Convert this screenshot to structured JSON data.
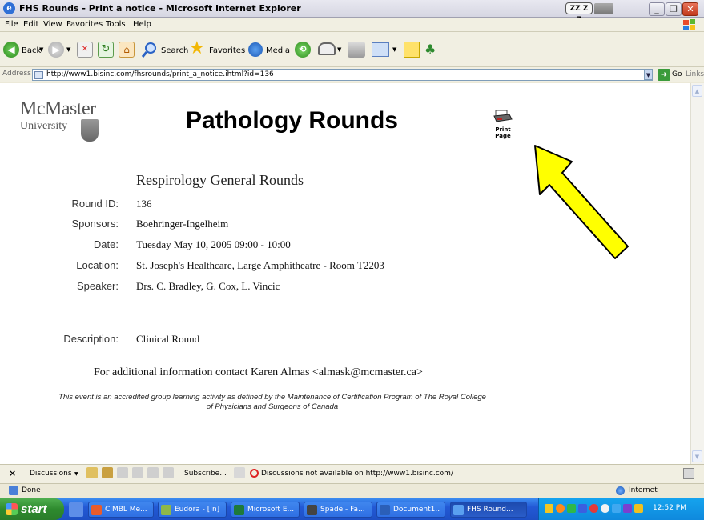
{
  "window": {
    "title": "FHS Rounds - Print a notice - Microsoft Internet Explorer",
    "zz_label": "ZZ Z Z"
  },
  "menu": [
    "File",
    "Edit",
    "View",
    "Favorites",
    "Tools",
    "Help"
  ],
  "toolbar": {
    "back_label": "Back",
    "search_label": "Search",
    "favorites_label": "Favorites",
    "media_label": "Media"
  },
  "address": {
    "label": "Address",
    "url": "http://www1.bisinc.com/fhsrounds/print_a_notice.ihtml?id=136",
    "go_label": "Go",
    "links_label": "Links"
  },
  "page": {
    "logo_line1": "McMaster",
    "logo_line2": "University",
    "title": "Pathology Rounds",
    "print_label_1": "Print",
    "print_label_2": "Page",
    "event_title": "Respirology General Rounds",
    "fields": [
      {
        "label": "Round ID:",
        "value": "136"
      },
      {
        "label": "Sponsors:",
        "value": "Boehringer-Ingelheim"
      },
      {
        "label": "Date:",
        "value": "Tuesday May 10, 2005 09:00 - 10:00"
      },
      {
        "label": "Location:",
        "value": "St. Joseph's Healthcare, Large Amphitheatre - Room T2203"
      },
      {
        "label": "Speaker:",
        "value": "Drs. C. Bradley, G. Cox, L. Vincic"
      }
    ],
    "description_label": "Description:",
    "description_value": "Clinical Round",
    "contact": "For additional information contact Karen Almas <almask@mcmaster.ca>",
    "accreditation_line1": "This event is an accredited group learning activity as defined by the Maintenance of Certification Program of The Royal College",
    "accreditation_line2": "of Physicians and Surgeons of Canada"
  },
  "discussions": {
    "label": "Discussions",
    "subscribe": "Subscribe...",
    "status": "Discussions not available on http://www1.bisinc.com/"
  },
  "status": {
    "text": "Done",
    "zone": "Internet"
  },
  "taskbar": {
    "start": "start",
    "tasks": [
      {
        "label": "CIMBL Me...",
        "active": false
      },
      {
        "label": "Eudora - [In]",
        "active": false
      },
      {
        "label": "Microsoft E...",
        "active": false
      },
      {
        "label": "Spade - Fa...",
        "active": false
      },
      {
        "label": "Document1...",
        "active": false
      },
      {
        "label": "FHS Round...",
        "active": true
      }
    ],
    "clock": "12:52 PM"
  },
  "colors": {
    "arrow_fill": "#ffff00",
    "taskbar_blue": "#2359d5",
    "start_green": "#2e8a2e"
  }
}
